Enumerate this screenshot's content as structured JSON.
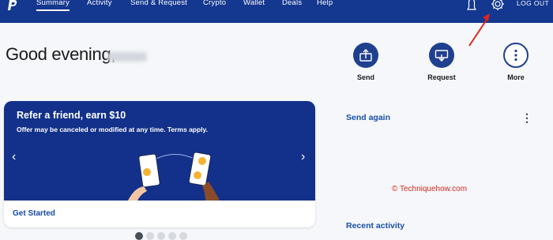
{
  "nav": {
    "items": [
      "Summary",
      "Activity",
      "Send & Request",
      "Crypto",
      "Wallet",
      "Deals",
      "Help"
    ],
    "logout": "LOG OUT"
  },
  "greeting": "Good evening,",
  "quick_actions": [
    "Send",
    "Request",
    "More"
  ],
  "promo": {
    "title": "Refer a friend, earn $10",
    "subtitle": "Offer may be canceled or modified at any time. Terms apply.",
    "cta": "Get Started"
  },
  "right_panel": {
    "send_again": "Send again",
    "recent_activity": "Recent activity"
  },
  "watermark": "© Techniquehow.com",
  "colors": {
    "nav_bg": "#14378f",
    "accent": "#1f3f8f",
    "link": "#1a4fa8",
    "annotation": "#e0241b"
  }
}
